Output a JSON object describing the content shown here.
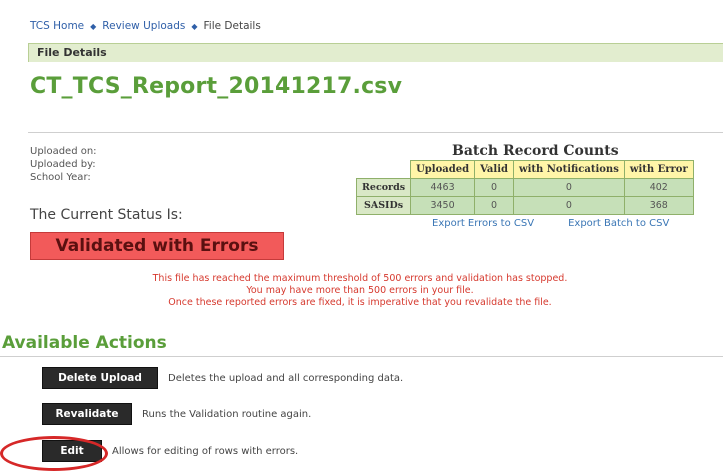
{
  "breadcrumb": {
    "items": [
      "TCS Home",
      "Review Uploads",
      "File Details"
    ],
    "separator": "◆"
  },
  "section": {
    "title": "File Details"
  },
  "file": {
    "name": "CT_TCS_Report_20141217.csv"
  },
  "meta": {
    "uploaded_on_label": "Uploaded on:",
    "uploaded_by_label": "Uploaded by:",
    "school_year_label": "School Year:"
  },
  "status": {
    "heading": "The Current Status Is:",
    "value": "Validated with Errors"
  },
  "batch": {
    "title": "Batch Record Counts",
    "columns": [
      "Uploaded",
      "Valid",
      "with Notifications",
      "with Error"
    ],
    "rows": [
      {
        "label": "Records",
        "values": [
          "4463",
          "0",
          "0",
          "402"
        ]
      },
      {
        "label": "SASIDs",
        "values": [
          "3450",
          "0",
          "0",
          "368"
        ]
      }
    ],
    "export_errors": "Export Errors to CSV",
    "export_batch": "Export Batch to CSV"
  },
  "warning": {
    "line1": "This file has reached the maximum threshold of 500 errors and validation has stopped.",
    "line2": "You may have more than 500 errors in your file.",
    "line3": "Once these reported errors are fixed, it is imperative that you revalidate the file."
  },
  "actions": {
    "heading": "Available Actions",
    "items": [
      {
        "label": "Delete Upload",
        "description": "Deletes the upload and all corresponding data."
      },
      {
        "label": "Revalidate",
        "description": "Runs the Validation routine again."
      },
      {
        "label": "Edit",
        "description": "Allows for editing of rows with errors."
      }
    ]
  },
  "colors": {
    "accent_green": "#5a9e3a",
    "status_red": "#f25a5a",
    "highlight_red": "#d62828"
  }
}
